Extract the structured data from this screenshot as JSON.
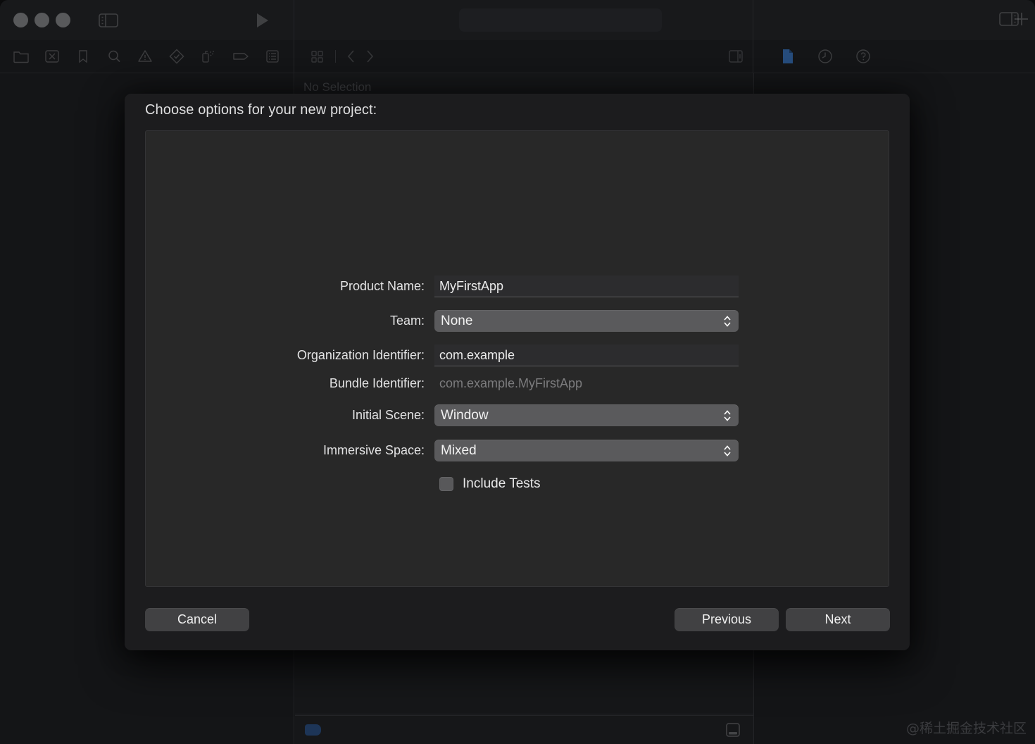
{
  "window": {
    "traffic_lights": [
      "close",
      "minimize",
      "zoom"
    ],
    "breadcrumb_no_selection": "No Selection",
    "background_no_selection": "ction"
  },
  "toolbar": {
    "navigator_icons": [
      "folder-icon",
      "source-control-icon",
      "bookmark-icon",
      "search-icon",
      "warning-icon",
      "test-diamond-icon",
      "debug-spray-icon",
      "breakpoint-tag-icon",
      "report-list-icon"
    ],
    "inspector_icons": [
      "file-inspector-icon",
      "history-inspector-icon",
      "quick-help-icon"
    ]
  },
  "dialog": {
    "title": "Choose options for your new project:",
    "fields": [
      {
        "label": "Product Name:",
        "type": "text",
        "value": "MyFirstApp"
      },
      {
        "label": "Team:",
        "type": "popup",
        "value": "None"
      },
      {
        "label": "Organization Identifier:",
        "type": "text",
        "value": "com.example"
      },
      {
        "label": "Bundle Identifier:",
        "type": "static",
        "value": "com.example.MyFirstApp"
      },
      {
        "label": "Initial Scene:",
        "type": "popup",
        "value": "Window"
      },
      {
        "label": "Immersive Space:",
        "type": "popup",
        "value": "Mixed"
      }
    ],
    "checkbox": {
      "label": "Include Tests",
      "checked": false
    },
    "buttons": {
      "cancel": "Cancel",
      "previous": "Previous",
      "next": "Next"
    }
  },
  "watermark": "@稀土掘金技术社区",
  "colors": {
    "sheet_bg": "#1c1c1e",
    "panel_bg": "#282828",
    "popup_bg": "#5a5a5c",
    "button_bg": "#414143",
    "window_bg": "#141517",
    "accent_blue": "#1d3557",
    "text_primary": "#e3e3e4",
    "text_muted": "#7c7c7e"
  }
}
